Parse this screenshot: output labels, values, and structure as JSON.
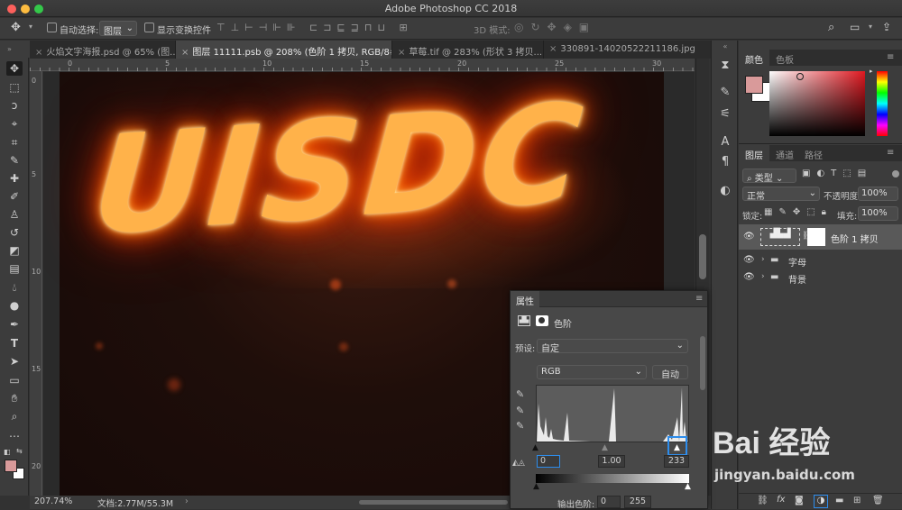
{
  "window": {
    "title": "Adobe Photoshop CC 2018"
  },
  "options_bar": {
    "auto_select_label": "自动选择:",
    "auto_select_value": "图层",
    "show_transform_label": "显示变换控件",
    "mode_3d_label": "3D 模式:"
  },
  "tabs": [
    {
      "label": "火焰文字海报.psd @ 65% (图..."
    },
    {
      "label": "图层 11111.psb @ 208% (色阶 1 拷贝, RGB/8#) *"
    },
    {
      "label": "草莓.tif @ 283% (形状 3 拷贝..."
    },
    {
      "label": "330891-14020522211186.jpg"
    }
  ],
  "ruler_top": [
    "0",
    "5",
    "10",
    "15",
    "20",
    "25",
    "30"
  ],
  "ruler_left": [
    "0",
    "5",
    "10",
    "15",
    "20",
    "25"
  ],
  "canvas": {
    "artwork_text": "UISDC"
  },
  "status": {
    "zoom": "207.74%",
    "doc": "文档:2.77M/55.3M"
  },
  "color_panel": {
    "tabs": [
      "颜色",
      "色板"
    ],
    "fg_color": "#d99a9a",
    "bg_color": "#ffffff"
  },
  "layers_panel": {
    "tabs": [
      "图层",
      "通道",
      "路径"
    ],
    "filter_label": "类型",
    "blend_mode": "正常",
    "opacity_label": "不透明度:",
    "opacity_value": "100%",
    "lock_label": "锁定:",
    "fill_label": "填充:",
    "fill_value": "100%",
    "layers": [
      {
        "name": "色阶 1 拷贝",
        "type": "adjustment"
      },
      {
        "name": "字母",
        "type": "group"
      },
      {
        "name": "背景",
        "type": "group"
      }
    ]
  },
  "properties_panel": {
    "tab": "属性",
    "adjustment_name": "色阶",
    "preset_label": "预设:",
    "preset_value": "自定",
    "channel_value": "RGB",
    "auto_button": "自动",
    "input_black": "0",
    "input_mid": "1.00",
    "input_white": "233",
    "output_label": "输出色阶:",
    "output_black": "0",
    "output_white": "255"
  },
  "watermark": {
    "brand": "Bai 经验",
    "url": "jingyan.baidu.com"
  },
  "colors": {
    "accent_blue": "#2d8ceb",
    "panel_bg": "#3c3c3c",
    "canvas_bg": "#2a2a2a"
  }
}
